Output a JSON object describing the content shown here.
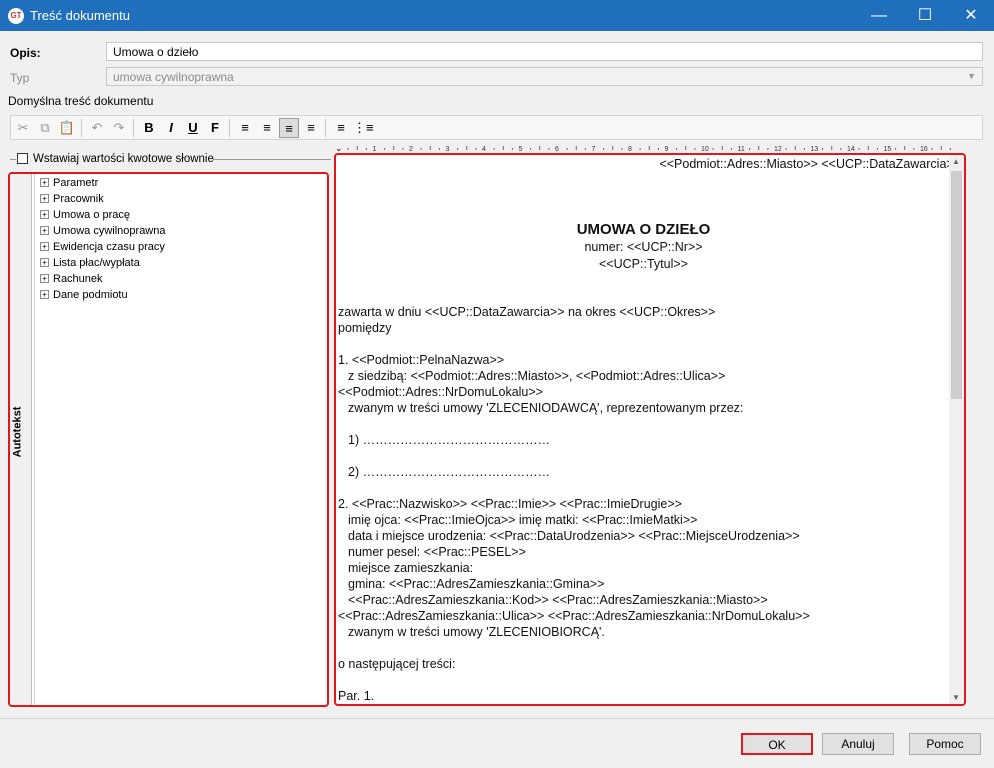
{
  "window": {
    "title": "Treść dokumentu",
    "app_icon_text": "GT"
  },
  "form": {
    "opis_label": "Opis:",
    "opis_value": "Umowa o dzieło",
    "typ_label": "Typ",
    "typ_value": "umowa cywilnoprawna",
    "default_content_label": "Domyślna treść dokumentu"
  },
  "toolbar": {
    "bold": "B",
    "italic": "I",
    "underline": "U",
    "font": "F"
  },
  "ruler": {
    "marks": [
      "1",
      "2",
      "3",
      "4",
      "5",
      "6",
      "7",
      "8",
      "9",
      "10",
      "11",
      "12",
      "13",
      "14",
      "15",
      "16"
    ]
  },
  "checkbox": {
    "label": "Wstawiaj wartości kwotowe słownie",
    "checked": false
  },
  "sidebar": {
    "tab_label": "Autotekst",
    "items": [
      {
        "label": "Parametr"
      },
      {
        "label": "Pracownik"
      },
      {
        "label": "Umowa o pracę"
      },
      {
        "label": "Umowa cywilnoprawna"
      },
      {
        "label": "Ewidencja czasu pracy"
      },
      {
        "label": "Lista płac/wypłata"
      },
      {
        "label": "Rachunek"
      },
      {
        "label": "Dane podmiotu"
      }
    ]
  },
  "document": {
    "header_right": "<<Podmiot::Adres::Miasto>> <<UCP::DataZawarcia>>",
    "title": "UMOWA O DZIEŁO",
    "number": "numer: <<UCP::Nr>>",
    "subtitle": "<<UCP::Tytul>>",
    "lines": [
      "zawarta w dniu <<UCP::DataZawarcia>> na okres <<UCP::Okres>>",
      "pomiędzy",
      "1. <<Podmiot::PelnaNazwa>>",
      "   z siedzibą: <<Podmiot::Adres::Miasto>>, <<Podmiot::Adres::Ulica>>",
      "<<Podmiot::Adres::NrDomuLokalu>>",
      "   zwanym w treści umowy 'ZLECENIODAWCĄ', reprezentowanym przez:",
      "   1) ………………………………………",
      "   2) ………………………………………",
      "2. <<Prac::Nazwisko>> <<Prac::Imie>> <<Prac::ImieDrugie>>",
      "   imię ojca:  <<Prac::ImieOjca>> imię matki: <<Prac::ImieMatki>>",
      "   data i miejsce urodzenia: <<Prac::DataUrodzenia>> <<Prac::MiejsceUrodzenia>>",
      "   numer pesel: <<Prac::PESEL>>",
      "   miejsce zamieszkania:",
      "   gmina: <<Prac::AdresZamieszkania::Gmina>>",
      "   <<Prac::AdresZamieszkania::Kod>> <<Prac::AdresZamieszkania::Miasto>>",
      "<<Prac::AdresZamieszkania::Ulica>> <<Prac::AdresZamieszkania::NrDomuLokalu>>",
      "   zwanym w treści umowy 'ZLECENIOBIORCĄ'.",
      "o następującej treści:",
      "Par. 1."
    ]
  },
  "buttons": {
    "ok": "OK",
    "cancel": "Anuluj",
    "help": "Pomoc"
  },
  "colors": {
    "titlebar": "#1f6fbd",
    "highlight": "#e0181b"
  }
}
